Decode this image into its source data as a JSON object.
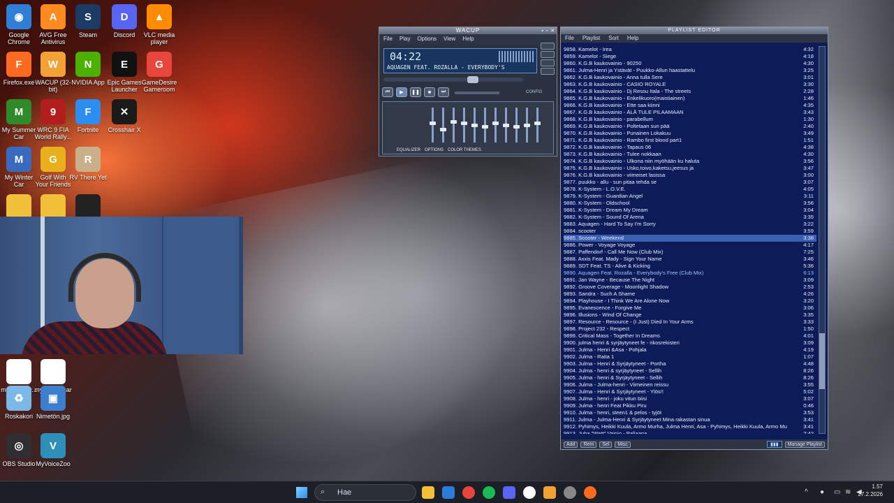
{
  "desktop_icons": [
    {
      "label": "Google Chrome",
      "glyph": "◉",
      "color": "#2f7fd8"
    },
    {
      "label": "AVG Free Antivirus",
      "glyph": "A",
      "color": "#ff8a1f"
    },
    {
      "label": "Steam",
      "glyph": "S",
      "color": "#1b3b64"
    },
    {
      "label": "Discord",
      "glyph": "D",
      "color": "#5865f2"
    },
    {
      "label": "VLC media player",
      "glyph": "▲",
      "color": "#ff8c00"
    },
    {
      "label": "Firefox.exe",
      "glyph": "F",
      "color": "#ff6a1f"
    },
    {
      "label": "WACUP (32-bit)",
      "glyph": "W",
      "color": "#f2a234"
    },
    {
      "label": "NVIDIA App",
      "glyph": "N",
      "color": "#4bb000"
    },
    {
      "label": "Epic Games Launcher",
      "glyph": "E",
      "color": "#111111"
    },
    {
      "label": "GameDesire Gameroom",
      "glyph": "G",
      "color": "#e8453c"
    },
    {
      "label": "My Summer Car",
      "glyph": "M",
      "color": "#2f8a2a"
    },
    {
      "label": "WRC 9 FIA World Rally...",
      "glyph": "9",
      "color": "#b21d1d"
    },
    {
      "label": "Fortnite",
      "glyph": "F",
      "color": "#2c8df0"
    },
    {
      "label": "Crosshair X",
      "glyph": "✕",
      "color": "#1a1a1a"
    },
    {
      "label": "My Winter Car",
      "glyph": "M",
      "color": "#3a6ac0"
    },
    {
      "label": "Golf With Your Friends",
      "glyph": "G",
      "color": "#e8b01c"
    },
    {
      "label": "RV There Yet",
      "glyph": "R",
      "color": "#c9b08a"
    },
    {
      "label": "",
      "glyph": "",
      "color": "#222222"
    },
    {
      "label": "",
      "glyph": "",
      "color": "#f2c038"
    },
    {
      "label": "",
      "glyph": "",
      "color": "#f2c038"
    },
    {
      "label": "mysummer...",
      "glyph": "",
      "color": "#ffffff"
    },
    {
      "label": "my winter car save",
      "glyph": "",
      "color": "#ffffff"
    },
    {
      "label": "Roskakori",
      "glyph": "♻",
      "color": "#7ab8e8"
    },
    {
      "label": "Nimetön.jpg",
      "glyph": "▣",
      "color": "#3d7fcf"
    },
    {
      "label": "OBS Studio",
      "glyph": "◎",
      "color": "#302e31"
    },
    {
      "label": "MyVoiceZoo",
      "glyph": "V",
      "color": "#2e8fb8"
    }
  ],
  "wacup": {
    "title": "WACUP",
    "menu": [
      "File",
      "Play",
      "Options",
      "View",
      "Help"
    ],
    "time": "04:22",
    "ticker": "AQUAGEN FEAT. ROZALLA - EVERYBODY'S",
    "config": "CONFIG",
    "eq_tabs": [
      "EQUALIZER",
      "OPTIONS",
      "COLOR THEMES"
    ],
    "eq_band_levels": [
      0.55,
      0.35,
      0.6,
      0.55,
      0.5,
      0.45,
      0.55,
      0.5,
      0.45,
      0.5,
      0.55
    ]
  },
  "playlist": {
    "title": "PLAYLIST EDITOR",
    "menu": [
      "File",
      "Playlist",
      "Sort",
      "Help"
    ],
    "bottom_buttons": [
      "Add",
      "Rem",
      "Sel",
      "Misc"
    ],
    "manage": "Manage Playlist",
    "items": [
      {
        "text": "9858. Kamelot - Irea",
        "dur": "4:32"
      },
      {
        "text": "9859. Kamelot - Siege",
        "dur": "4:18"
      },
      {
        "text": "9860. K.G.B kaukovainio - 90250",
        "dur": "4:30"
      },
      {
        "text": "9861. Julma-Henri ja Ystävät - Puukko-Allun haastattelu",
        "dur": "3:25"
      },
      {
        "text": "9862. K.G.B kaukovainio - Anna tulla Sere",
        "dur": "3:01"
      },
      {
        "text": "9863. K.G.B kaukovainio - CASIO ROYALE",
        "dur": "3:30"
      },
      {
        "text": "9864. K.G.B kaukovainio - Dj Ressu Itala - The streets",
        "dur": "2:28"
      },
      {
        "text": "9865. K.G.B kaukovainio - Enkelikuoro(maistiainen)",
        "dur": "1:46"
      },
      {
        "text": "9866. K.G.B kaukovainio - Ette saa kiinni",
        "dur": "4:35"
      },
      {
        "text": "9867. K.G.B kaukovainio - ÄLÄ TULE PILAAMAAN",
        "dur": "3:43"
      },
      {
        "text": "9868. K.G.B kaukovainio - parabellum",
        "dur": "1:30"
      },
      {
        "text": "9869. K.G.B kaukovainio - Poltetaan sun pää",
        "dur": "2:40"
      },
      {
        "text": "9870. K.G.B kaukovainio - Punainen Lokakuu",
        "dur": "3:49"
      },
      {
        "text": "9871. K.G.B kaukovainio - Rambo first blood part1",
        "dur": "1:51"
      },
      {
        "text": "9872. K.G.B kaukovainio - Tapaus 06",
        "dur": "4:38"
      },
      {
        "text": "9873. K.G.B kaukovainio - Tulee nokkaan",
        "dur": "4:30"
      },
      {
        "text": "9874. K.G.B kaukovainio - Ulkona niin myöhään ku haluta",
        "dur": "3:56"
      },
      {
        "text": "9875. K.G.B kaukovainio - Usko,toivo,kaketsu,jeesus ja",
        "dur": "3:47"
      },
      {
        "text": "9876. K.G.B kaukovainio - viimeiset lasissa",
        "dur": "3:00"
      },
      {
        "text": "9877. puukko - allu - sun pitaa tehda se",
        "dur": "3:07"
      },
      {
        "text": "9878. K-System - L.O.V.E.",
        "dur": "4:05"
      },
      {
        "text": "9879. K-System - Guardian Angel",
        "dur": "3:11"
      },
      {
        "text": "9880. K-System - Oldschool",
        "dur": "3:56"
      },
      {
        "text": "9881. K-System - Dream My Dream",
        "dur": "3:04"
      },
      {
        "text": "9882. K-System - Sound Of Arena",
        "dur": "3:35"
      },
      {
        "text": "9883. Aquagen - Hard To Say I'm Sorry",
        "dur": "3:22"
      },
      {
        "text": "9884. scooter",
        "dur": "3:59"
      },
      {
        "text": "9885. Scooter - Weekend",
        "dur": "3:38"
      },
      {
        "text": "9886. Power - Voyage Voyage",
        "dur": "4:17"
      },
      {
        "text": "9887. Paffendorf - Call Me Now (Club Mix)",
        "dur": "7:25"
      },
      {
        "text": "9888. Axxis Feat. Mady - Sign Your Name",
        "dur": "3:46"
      },
      {
        "text": "9889. SDT Feat. TS - Alive & Kicking",
        "dur": "5:36"
      },
      {
        "text": "9890. Aquagen Feat. Rozalla - Everybody's Free (Club Mix)",
        "dur": "6:13"
      },
      {
        "text": "9891. Jan Wayne - Because The Night",
        "dur": "3:09"
      },
      {
        "text": "9892. Groove Coverage - Moonlight Shadow",
        "dur": "2:53"
      },
      {
        "text": "9893. Sandra - Such A Shame",
        "dur": "4:26"
      },
      {
        "text": "9894. Playhouse - I Think We Are Alone Now",
        "dur": "3:20"
      },
      {
        "text": "9895. Evanescence - Forgive Me",
        "dur": "3:06"
      },
      {
        "text": "9896. Illusions - Wind Of Change",
        "dur": "3:35"
      },
      {
        "text": "9897. Resource - Resource - (I Just) Died In Your Arms",
        "dur": "3:33"
      },
      {
        "text": "9898. Project 232 - Respect",
        "dur": "1:50"
      },
      {
        "text": "9899. Critical Mass - Together In Dreams",
        "dur": "4:01"
      },
      {
        "text": "9900. julma henri & syrjäytyneet fe - rikosrekisteri",
        "dur": "3:09"
      },
      {
        "text": "9901. Julma - Henri &Asa - Pohjala",
        "dur": "4:19"
      },
      {
        "text": "9902. Julma - Raita 1",
        "dur": "1:07"
      },
      {
        "text": "9903. Julma - Henri & Syrjäytyneet - Portha",
        "dur": "4:48"
      },
      {
        "text": "9904. Julma - henri & syrjäytyneet - Sellih",
        "dur": "8:26"
      },
      {
        "text": "9905. Julma - henri & Syrjäytyneet - Sellih",
        "dur": "8:26"
      },
      {
        "text": "9906. Julma - Julma-henri - Viimeinen reissu",
        "dur": "3:55"
      },
      {
        "text": "9907. Julma - Henri & Syrjäytyneet - Ylös!!",
        "dur": "5:02"
      },
      {
        "text": "9908. Julma - henri - joku vitun biisi",
        "dur": "3:07"
      },
      {
        "text": "9909. Julma - henri Feat Pikku Piru",
        "dur": "0:46"
      },
      {
        "text": "9910. Julma - henri, steen1 & pelos - tyjöt",
        "dur": "3:53"
      },
      {
        "text": "9911. Julma - Julma-Henri & Syrjäytyneet Mina rakastan sinua",
        "dur": "3:41"
      },
      {
        "text": "9912. Pyhimys, Heikki Kuula, Armo Murha, Julma Henri, Asa - Pyhimys, Heikki Kuula, Armo Mur...",
        "dur": "3:41"
      },
      {
        "text": "9913. Juha \"Watt\" Vainio - Paljaana",
        "dur": "2:42"
      }
    ]
  },
  "taskbar": {
    "search_placeholder": "Hae",
    "time": "1.57",
    "date": "27.2.2026"
  }
}
